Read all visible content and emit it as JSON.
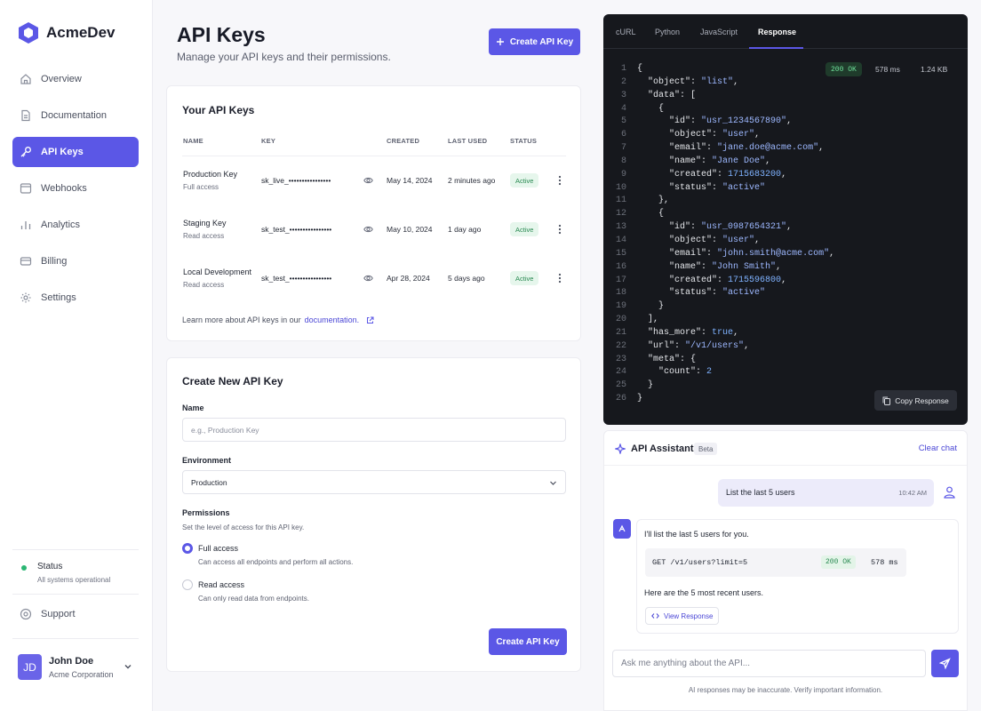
{
  "brand": {
    "name": "AcmeDev"
  },
  "nav": [
    {
      "label": "Overview",
      "icon": "home-icon"
    },
    {
      "label": "Documentation",
      "icon": "document-icon"
    },
    {
      "label": "API Keys",
      "icon": "key-icon",
      "active": true
    },
    {
      "label": "Webhooks",
      "icon": "webhook-icon"
    },
    {
      "label": "Analytics",
      "icon": "bar-chart-icon"
    },
    {
      "label": "Billing",
      "icon": "credit-card-icon"
    },
    {
      "label": "Settings",
      "icon": "gear-icon"
    }
  ],
  "status": {
    "title": "Status",
    "detail": "All systems operational",
    "color": "#2bb673"
  },
  "support": {
    "label": "Support"
  },
  "user": {
    "initials": "JD",
    "name": "John Doe",
    "org": "Acme Corporation"
  },
  "header": {
    "title": "API Keys",
    "subtitle": "Manage your API keys and their permissions.",
    "create_button": "Create API Key"
  },
  "keys_card": {
    "title": "Your API Keys",
    "columns": {
      "name": "NAME",
      "key": "KEY",
      "created": "CREATED",
      "last_used": "LAST USED",
      "status": "STATUS"
    },
    "rows": [
      {
        "name": "Production Key",
        "access": "Full access",
        "key": "sk_live_••••••••••••••••",
        "created": "May 14, 2024",
        "last_used": "2 minutes ago",
        "status": "Active"
      },
      {
        "name": "Staging Key",
        "access": "Read access",
        "key": "sk_test_••••••••••••••••",
        "created": "May 10, 2024",
        "last_used": "1 day ago",
        "status": "Active"
      },
      {
        "name": "Local Development",
        "access": "Read access",
        "key": "sk_test_••••••••••••••••",
        "created": "Apr 28, 2024",
        "last_used": "5 days ago",
        "status": "Active"
      }
    ],
    "learn_more_prefix": "Learn more about API keys in our",
    "learn_more_link": "documentation."
  },
  "create_card": {
    "title": "Create New API Key",
    "name_label": "Name",
    "name_placeholder": "e.g., Production Key",
    "environment_label": "Environment",
    "environment_value": "Production",
    "permissions_label": "Permissions",
    "permissions_hint": "Set the level of access for this API key.",
    "options": [
      {
        "title": "Full access",
        "description": "Can access all endpoints and perform all actions.",
        "selected": true
      },
      {
        "title": "Read access",
        "description": "Can only read data from endpoints.",
        "selected": false
      }
    ],
    "submit": "Create API Key"
  },
  "code_panel": {
    "tabs": [
      "cURL",
      "Python",
      "JavaScript",
      "Response"
    ],
    "active_tab": "Response",
    "status": "200 OK",
    "time": "578 ms",
    "size": "1.24 KB",
    "line_numbers": [
      "1",
      "2",
      "3",
      "4",
      "5",
      "6",
      "7",
      "8",
      "9",
      "10",
      "11",
      "12",
      "13",
      "14",
      "15",
      "16",
      "17",
      "18",
      "19",
      "20",
      "21",
      "22",
      "23",
      "24",
      "25",
      "26"
    ],
    "lines": [
      "{",
      "  \"object\": \"list\",",
      "  \"data\": [",
      "    {",
      "      \"id\": \"usr_1234567890\",",
      "      \"object\": \"user\",",
      "      \"email\": \"jane.doe@acme.com\",",
      "      \"name\": \"Jane Doe\",",
      "      \"created\": 1715683200,",
      "      \"status\": \"active\"",
      "    },",
      "    {",
      "      \"id\": \"usr_0987654321\",",
      "      \"object\": \"user\",",
      "      \"email\": \"john.smith@acme.com\",",
      "      \"name\": \"John Smith\",",
      "      \"created\": 1715596800,",
      "      \"status\": \"active\"",
      "    }",
      "  ],",
      "  \"has_more\": true,",
      "  \"url\": \"/v1/users\",",
      "  \"meta\": {",
      "    \"count\": 2",
      "  }",
      "}"
    ],
    "syntax_colors": {
      "key": "#e4e6ea",
      "string": "#9db8ff",
      "number": "#7fb2ff",
      "punct": "#e4e6ea"
    },
    "copy_label": "Copy Response"
  },
  "assistant": {
    "title": "API Assistant",
    "badge": "Beta",
    "clear": "Clear chat",
    "user_message": "List the last 5 users",
    "user_time": "10:42 AM",
    "bot_intro": "I'll list the last 5 users for you.",
    "request": "GET /v1/users?limit=5",
    "request_status": "200 OK",
    "request_time": "578 ms",
    "bot_result": "Here are the 5 most recent users.",
    "view_response": "View Response",
    "input_placeholder": "Ask me anything about the API...",
    "disclaimer": "AI responses may be inaccurate. Verify important information."
  },
  "colors": {
    "accent": "#5b57e6",
    "success": "#2bb673",
    "code_bg": "#16181d"
  }
}
